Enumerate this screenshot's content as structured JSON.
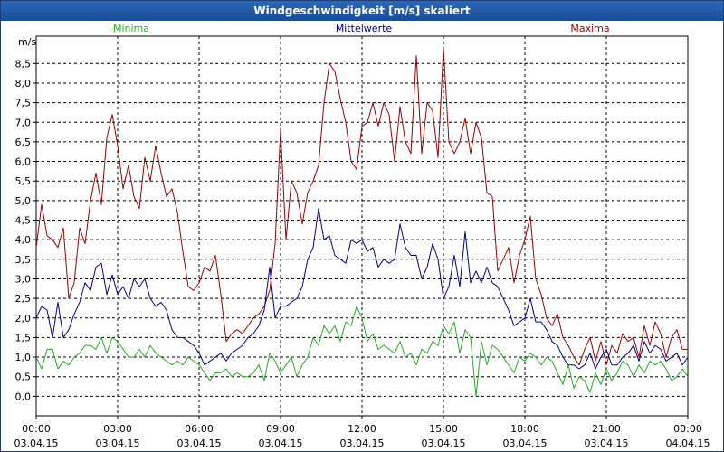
{
  "window": {
    "title": "Windgeschwindigkeit [m/s] skaliert"
  },
  "chart_data": {
    "type": "line",
    "title": "Windgeschwindigkeit [m/s] skaliert",
    "ylabel": "m/s",
    "xlabel": "",
    "ylim": [
      -0.5,
      9.2
    ],
    "xlim": [
      0,
      24
    ],
    "grid": true,
    "legend_placement": "top",
    "y_ticks": [
      "0,0",
      "0,5",
      "1,0",
      "1,5",
      "2,0",
      "2,5",
      "3,0",
      "3,5",
      "4,0",
      "4,5",
      "5,0",
      "5,5",
      "6,0",
      "6,5",
      "7,0",
      "7,5",
      "8,0",
      "8,5"
    ],
    "y_tick_values": [
      0,
      0.5,
      1,
      1.5,
      2,
      2.5,
      3,
      3.5,
      4,
      4.5,
      5,
      5.5,
      6,
      6.5,
      7,
      7.5,
      8,
      8.5
    ],
    "x_ticks": [
      {
        "time": "00:00",
        "date": "03.04.15"
      },
      {
        "time": "03:00",
        "date": "03.04.15"
      },
      {
        "time": "06:00",
        "date": "03.04.15"
      },
      {
        "time": "09:00",
        "date": "03.04.15"
      },
      {
        "time": "12:00",
        "date": "03.04.15"
      },
      {
        "time": "15:00",
        "date": "03.04.15"
      },
      {
        "time": "18:00",
        "date": "03.04.15"
      },
      {
        "time": "21:00",
        "date": "03.04.15"
      },
      {
        "time": "00:00",
        "date": "04.04.15"
      }
    ],
    "x_tick_hours": [
      0,
      3,
      6,
      9,
      12,
      15,
      18,
      21,
      24
    ],
    "series": [
      {
        "name": "Maxima",
        "color": "#990000",
        "x": [
          0,
          0.2,
          0.4,
          0.6,
          0.8,
          1.0,
          1.2,
          1.4,
          1.6,
          1.8,
          2.0,
          2.2,
          2.4,
          2.6,
          2.8,
          3.0,
          3.2,
          3.4,
          3.6,
          3.8,
          4.0,
          4.2,
          4.4,
          4.6,
          4.8,
          5.0,
          5.2,
          5.4,
          5.6,
          5.8,
          6.0,
          6.2,
          6.4,
          6.6,
          6.8,
          7.0,
          7.2,
          7.4,
          7.6,
          7.8,
          8.0,
          8.2,
          8.4,
          8.6,
          8.8,
          9.0,
          9.2,
          9.4,
          9.6,
          9.8,
          10.0,
          10.2,
          10.4,
          10.6,
          10.8,
          11.0,
          11.2,
          11.4,
          11.6,
          11.8,
          12.0,
          12.2,
          12.4,
          12.6,
          12.8,
          13.0,
          13.2,
          13.4,
          13.6,
          13.8,
          14.0,
          14.2,
          14.4,
          14.6,
          14.8,
          15.0,
          15.2,
          15.4,
          15.6,
          15.8,
          16.0,
          16.2,
          16.4,
          16.6,
          16.8,
          17.0,
          17.2,
          17.4,
          17.6,
          17.8,
          18.0,
          18.2,
          18.4,
          18.6,
          18.8,
          19.0,
          19.2,
          19.4,
          19.6,
          19.8,
          20.0,
          20.2,
          20.4,
          20.6,
          20.8,
          21.0,
          21.2,
          21.4,
          21.6,
          21.8,
          22.0,
          22.2,
          22.4,
          22.6,
          22.8,
          23.0,
          23.2,
          23.4,
          23.6,
          23.8,
          24.0
        ],
        "values": [
          3.8,
          4.9,
          4.1,
          4.0,
          3.8,
          4.3,
          2.5,
          2.9,
          4.3,
          3.9,
          5.0,
          5.7,
          4.9,
          6.6,
          7.2,
          6.4,
          5.3,
          5.9,
          5.1,
          4.8,
          6.1,
          5.5,
          6.4,
          5.7,
          5.1,
          5.3,
          4.7,
          3.7,
          2.8,
          2.7,
          2.9,
          3.3,
          3.2,
          3.6,
          2.6,
          1.4,
          1.6,
          1.7,
          1.6,
          1.8,
          2.0,
          2.1,
          2.3,
          2.7,
          3.9,
          6.8,
          4.0,
          5.5,
          5.2,
          4.4,
          5.2,
          5.5,
          5.9,
          7.5,
          8.5,
          8.3,
          7.6,
          7.0,
          6.0,
          5.8,
          6.9,
          7.0,
          7.5,
          6.9,
          7.5,
          7.2,
          6.0,
          7.4,
          6.5,
          6.2,
          8.7,
          6.2,
          7.5,
          7.3,
          6.1,
          8.9,
          6.5,
          6.2,
          6.5,
          7.1,
          6.2,
          7.0,
          6.6,
          5.2,
          5.1,
          3.2,
          3.5,
          3.8,
          2.9,
          3.6,
          4.0,
          4.6,
          3.0,
          2.6,
          2.0,
          1.8,
          2.1,
          1.5,
          1.3,
          1.0,
          0.8,
          1.2,
          1.5,
          0.9,
          1.4,
          0.8,
          1.3,
          1.1,
          1.6,
          1.4,
          1.5,
          1.0,
          1.8,
          1.3,
          1.9,
          1.6,
          1.0,
          1.5,
          1.7,
          1.2,
          1.2
        ],
        "legend_label": "Maxima"
      },
      {
        "name": "Mittelwerte",
        "color": "#00008b",
        "x": [
          0,
          0.2,
          0.4,
          0.6,
          0.8,
          1.0,
          1.2,
          1.4,
          1.6,
          1.8,
          2.0,
          2.2,
          2.4,
          2.6,
          2.8,
          3.0,
          3.2,
          3.4,
          3.6,
          3.8,
          4.0,
          4.2,
          4.4,
          4.6,
          4.8,
          5.0,
          5.2,
          5.4,
          5.6,
          5.8,
          6.0,
          6.2,
          6.4,
          6.6,
          6.8,
          7.0,
          7.2,
          7.4,
          7.6,
          7.8,
          8.0,
          8.2,
          8.4,
          8.6,
          8.8,
          9.0,
          9.2,
          9.4,
          9.6,
          9.8,
          10.0,
          10.2,
          10.4,
          10.6,
          10.8,
          11.0,
          11.2,
          11.4,
          11.6,
          11.8,
          12.0,
          12.2,
          12.4,
          12.6,
          12.8,
          13.0,
          13.2,
          13.4,
          13.6,
          13.8,
          14.0,
          14.2,
          14.4,
          14.6,
          14.8,
          15.0,
          15.2,
          15.4,
          15.6,
          15.8,
          16.0,
          16.2,
          16.4,
          16.6,
          16.8,
          17.0,
          17.2,
          17.4,
          17.6,
          17.8,
          18.0,
          18.2,
          18.4,
          18.6,
          18.8,
          19.0,
          19.2,
          19.4,
          19.6,
          19.8,
          20.0,
          20.2,
          20.4,
          20.6,
          20.8,
          21.0,
          21.2,
          21.4,
          21.6,
          21.8,
          22.0,
          22.2,
          22.4,
          22.6,
          22.8,
          23.0,
          23.2,
          23.4,
          23.6,
          23.8,
          24.0
        ],
        "values": [
          2.0,
          2.3,
          2.2,
          1.5,
          2.4,
          1.5,
          1.7,
          2.1,
          2.4,
          2.9,
          2.7,
          3.3,
          3.4,
          2.6,
          3.1,
          2.6,
          2.8,
          2.5,
          3.0,
          2.8,
          3.0,
          2.5,
          2.3,
          2.4,
          2.2,
          1.7,
          1.5,
          1.5,
          1.4,
          1.3,
          1.1,
          0.8,
          0.9,
          1.0,
          1.1,
          0.9,
          1.1,
          1.2,
          1.3,
          1.5,
          1.6,
          1.8,
          2.2,
          3.3,
          2.0,
          2.3,
          2.3,
          2.4,
          2.5,
          2.8,
          3.5,
          3.8,
          4.8,
          4.0,
          4.1,
          3.6,
          3.5,
          3.4,
          4.0,
          3.9,
          4.0,
          3.7,
          3.8,
          3.3,
          3.5,
          3.4,
          3.5,
          4.4,
          3.8,
          3.6,
          3.6,
          3.0,
          3.3,
          3.9,
          3.5,
          2.5,
          2.8,
          3.6,
          2.8,
          4.2,
          2.9,
          3.2,
          2.9,
          3.3,
          2.9,
          2.8,
          2.5,
          2.2,
          1.8,
          1.9,
          2.0,
          2.5,
          1.9,
          1.9,
          1.7,
          1.4,
          1.3,
          1.0,
          0.8,
          0.8,
          0.7,
          0.8,
          1.1,
          0.7,
          1.0,
          1.2,
          0.8,
          0.8,
          1.0,
          1.1,
          1.3,
          0.9,
          1.4,
          1.1,
          1.3,
          1.2,
          0.9,
          1.0,
          1.1,
          0.8,
          1.0
        ],
        "legend_label": "Mittelwerte"
      },
      {
        "name": "Minima",
        "color": "#22aa22",
        "x": [
          0,
          0.2,
          0.4,
          0.6,
          0.8,
          1.0,
          1.2,
          1.4,
          1.6,
          1.8,
          2.0,
          2.2,
          2.4,
          2.6,
          2.8,
          3.0,
          3.2,
          3.4,
          3.6,
          3.8,
          4.0,
          4.2,
          4.4,
          4.6,
          4.8,
          5.0,
          5.2,
          5.4,
          5.6,
          5.8,
          6.0,
          6.2,
          6.4,
          6.6,
          6.8,
          7.0,
          7.2,
          7.4,
          7.6,
          7.8,
          8.0,
          8.2,
          8.4,
          8.6,
          8.8,
          9.0,
          9.2,
          9.4,
          9.6,
          9.8,
          10.0,
          10.2,
          10.4,
          10.6,
          10.8,
          11.0,
          11.2,
          11.4,
          11.6,
          11.8,
          12.0,
          12.2,
          12.4,
          12.6,
          12.8,
          13.0,
          13.2,
          13.4,
          13.6,
          13.8,
          14.0,
          14.2,
          14.4,
          14.6,
          14.8,
          15.0,
          15.2,
          15.4,
          15.6,
          15.8,
          16.0,
          16.2,
          16.4,
          16.6,
          16.8,
          17.0,
          17.2,
          17.4,
          17.6,
          17.8,
          18.0,
          18.2,
          18.4,
          18.6,
          18.8,
          19.0,
          19.2,
          19.4,
          19.6,
          19.8,
          20.0,
          20.2,
          20.4,
          20.6,
          20.8,
          21.0,
          21.2,
          21.4,
          21.6,
          21.8,
          22.0,
          22.2,
          22.4,
          22.6,
          22.8,
          23.0,
          23.2,
          23.4,
          23.6,
          23.8,
          24.0
        ],
        "values": [
          1.0,
          0.7,
          1.2,
          1.2,
          0.7,
          0.9,
          0.8,
          1.0,
          1.1,
          1.3,
          1.3,
          1.2,
          1.5,
          1.1,
          1.5,
          1.4,
          1.2,
          1.0,
          1.0,
          1.2,
          1.0,
          1.3,
          1.1,
          1.0,
          0.9,
          0.8,
          0.9,
          0.8,
          1.0,
          0.9,
          0.8,
          0.6,
          0.4,
          0.6,
          0.6,
          0.7,
          0.5,
          0.6,
          0.5,
          0.5,
          0.6,
          0.8,
          0.4,
          1.1,
          0.9,
          0.6,
          0.8,
          1.0,
          0.5,
          0.8,
          1.0,
          1.5,
          1.3,
          1.8,
          1.6,
          1.8,
          1.4,
          1.9,
          1.8,
          2.3,
          2.0,
          1.4,
          1.6,
          1.2,
          1.3,
          1.2,
          1.1,
          1.4,
          1.0,
          1.1,
          0.8,
          1.2,
          1.1,
          1.4,
          1.3,
          1.8,
          1.6,
          1.9,
          1.1,
          1.7,
          1.5,
          0.0,
          1.4,
          0.8,
          1.3,
          1.2,
          1.0,
          0.8,
          0.6,
          1.0,
          0.9,
          1.1,
          1.0,
          0.8,
          1.0,
          0.9,
          0.6,
          0.3,
          0.8,
          0.2,
          0.5,
          0.4,
          0.1,
          0.6,
          0.3,
          0.7,
          0.4,
          0.6,
          0.9,
          0.8,
          0.5,
          0.8,
          0.6,
          0.9,
          0.8,
          0.9,
          0.7,
          0.4,
          0.5,
          0.7,
          0.5
        ],
        "legend_label": "Minima"
      }
    ]
  }
}
